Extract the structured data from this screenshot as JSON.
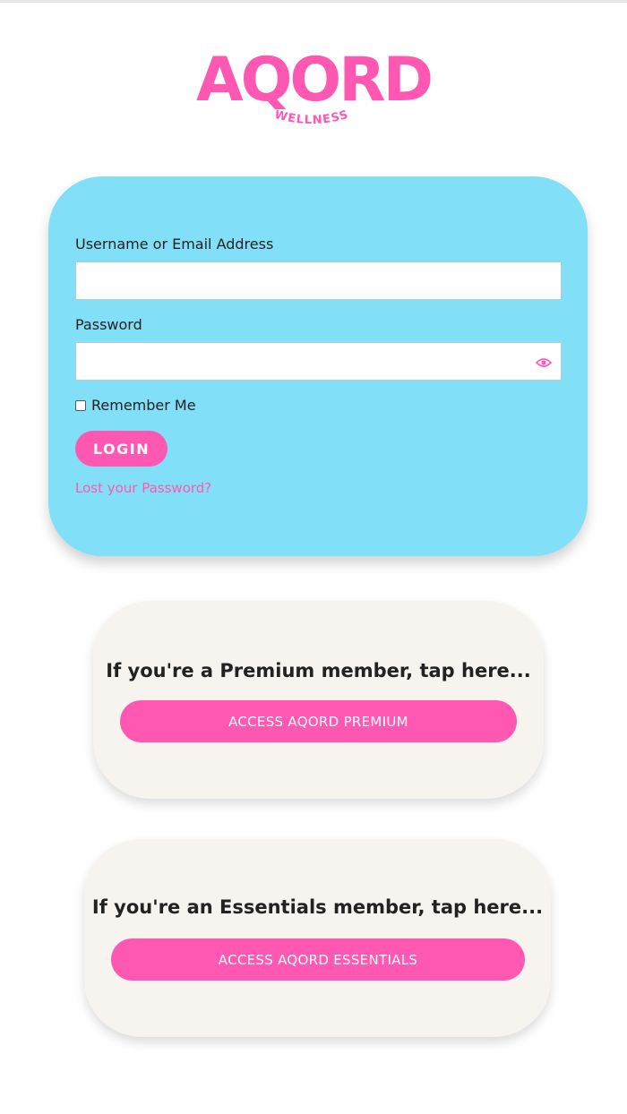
{
  "brand": {
    "name": "AQORD",
    "tagline": "WELLNESS",
    "accent_color": "#ff58b3",
    "card_color": "#82dff8"
  },
  "login": {
    "username_label": "Username or Email Address",
    "username_value": "",
    "password_label": "Password",
    "password_value": "",
    "password_toggle_icon": "eye-icon",
    "remember_label": "Remember Me",
    "remember_checked": false,
    "login_button": "LOGIN",
    "lost_password": "Lost your Password?"
  },
  "members": {
    "premium": {
      "heading": "If you're a Premium member, tap here...",
      "button": "ACCESS AQORD PREMIUM"
    },
    "essentials": {
      "heading": "If you're an Essentials member, tap here...",
      "button": "ACCESS AQORD ESSENTIALS"
    }
  }
}
